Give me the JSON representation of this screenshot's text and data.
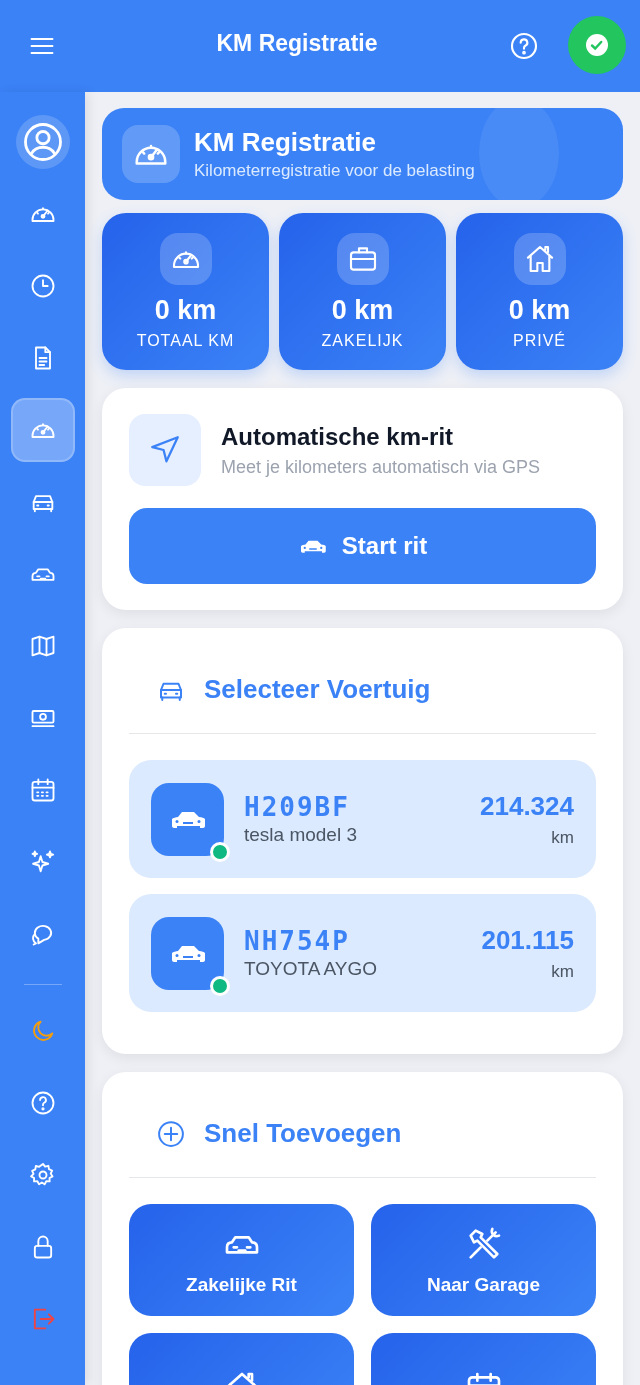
{
  "header": {
    "title": "KM Registratie",
    "sync_ok": true
  },
  "sidebar": {
    "items": [
      {
        "selected": false
      },
      {
        "selected": false
      },
      {
        "selected": false
      },
      {
        "selected": false
      },
      {
        "selected": true
      },
      {
        "selected": false
      },
      {
        "selected": false
      },
      {
        "selected": false
      },
      {
        "selected": false
      },
      {
        "selected": false
      },
      {
        "selected": false
      },
      {
        "selected": false
      }
    ],
    "footer_items": [
      {
        "selected": false
      },
      {
        "selected": false
      },
      {
        "selected": false
      },
      {
        "selected": false
      },
      {
        "selected": false
      }
    ]
  },
  "hero": {
    "title": "KM Registratie",
    "subtitle": "Kilometerregistratie voor de belasting"
  },
  "stats": [
    {
      "kind": "gauge",
      "value": "0 km",
      "label": "TOTAAL KM"
    },
    {
      "kind": "briefcase",
      "value": "0 km",
      "label": "ZAKELIJK"
    },
    {
      "kind": "home",
      "value": "0 km",
      "label": "PRIVÉ"
    }
  ],
  "auto_trip": {
    "title": "Automatische km-rit",
    "subtitle": "Meet je kilometers automatisch via GPS",
    "button": "Start rit"
  },
  "vehicles": {
    "title": "Selecteer Voertuig",
    "items": [
      {
        "plate": "H209BF",
        "model": "tesla model 3",
        "mileage": "214.324",
        "unit": "km",
        "active": true
      },
      {
        "plate": "NH754P",
        "model": "TOYOTA AYGO",
        "mileage": "201.115",
        "unit": "km",
        "active": true
      }
    ]
  },
  "quick_add": {
    "title": "Snel Toevoegen",
    "actions": [
      {
        "kind": "car",
        "label": "Zakelijke Rit"
      },
      {
        "kind": "tools",
        "label": "Naar Garage"
      },
      {
        "kind": "home"
      },
      {
        "kind": "calendar"
      }
    ]
  }
}
